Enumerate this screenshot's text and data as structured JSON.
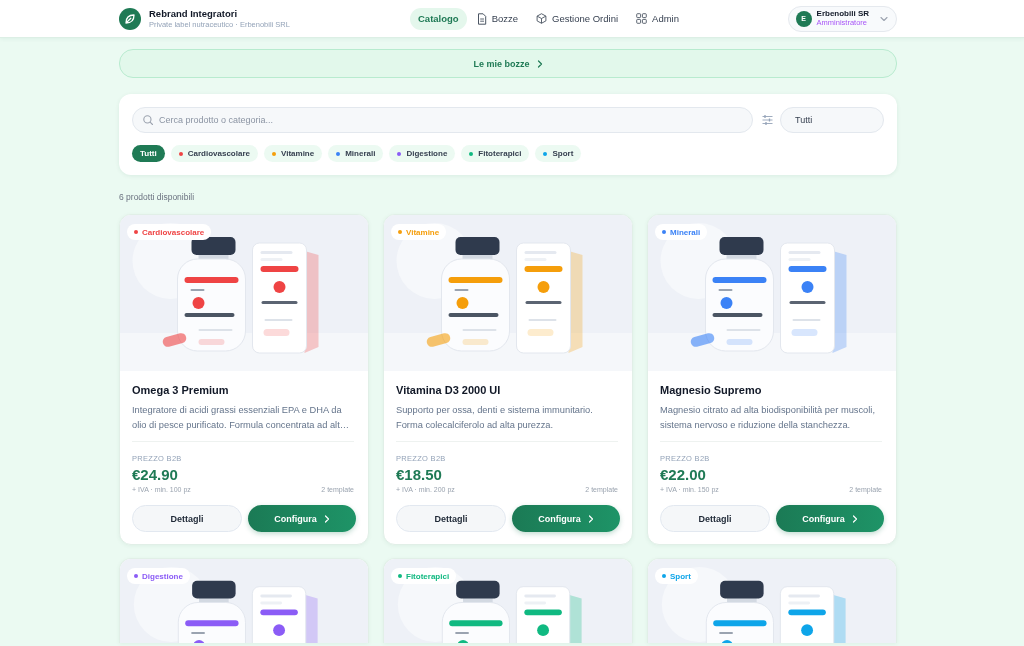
{
  "header": {
    "title": "Rebrand Integratori",
    "subtitle": "Private label nutraceutico · Erbenobili SRL"
  },
  "nav": [
    {
      "label": "Catalogo",
      "selected": true
    },
    {
      "label": "Bozze",
      "selected": false
    },
    {
      "label": "Gestione Ordini",
      "selected": false
    },
    {
      "label": "Admin",
      "selected": false
    }
  ],
  "user": {
    "initial": "E",
    "name": "Erbenobili SR",
    "role": "Amministratore"
  },
  "drafts_link": {
    "label": "Le mie bozze"
  },
  "filters": {
    "search": {
      "placeholder": "Cerca prodotto o categoria..."
    },
    "select": {
      "value": "Tutti"
    },
    "chips": [
      {
        "label": "Tutti",
        "selected": true
      },
      {
        "label": "Cardiovascolare",
        "selected": false,
        "color": "#ef4444"
      },
      {
        "label": "Vitamine",
        "selected": false,
        "color": "#f59e0b"
      },
      {
        "label": "Minerali",
        "selected": false,
        "color": "#3b82f6"
      },
      {
        "label": "Digestione",
        "selected": false,
        "color": "#8b5cf6"
      },
      {
        "label": "Fitoterapici",
        "selected": false,
        "color": "#10b981"
      },
      {
        "label": "Sport",
        "selected": false,
        "color": "#0ea5e9"
      }
    ]
  },
  "result_count": "6 prodotti disponibili",
  "products": [
    {
      "category": "Cardiovascolare",
      "color": "#ef4444",
      "name": "Omega 3 Premium",
      "description": "Integratore di acidi grassi essenziali EPA e DHA da olio di pesce purificato. Formula concentrata ad alt…",
      "price_label": "PREZZO B2B",
      "price": "€24.90",
      "terms": "+ IVA · min. 100 pz",
      "templates": "2 template",
      "details_button": "Dettagli",
      "configure_button": "Configura"
    },
    {
      "category": "Vitamine",
      "color": "#f59e0b",
      "name": "Vitamina D3 2000 UI",
      "description": "Supporto per ossa, denti e sistema immunitario. Forma colecalciferolo ad alta purezza.",
      "price_label": "PREZZO B2B",
      "price": "€18.50",
      "terms": "+ IVA · min. 200 pz",
      "templates": "2 template",
      "details_button": "Dettagli",
      "configure_button": "Configura"
    },
    {
      "category": "Minerali",
      "color": "#3b82f6",
      "name": "Magnesio Supremo",
      "description": "Magnesio citrato ad alta biodisponibilità per muscoli, sistema nervoso e riduzione della stanchezza.",
      "price_label": "PREZZO B2B",
      "price": "€22.00",
      "terms": "+ IVA · min. 150 pz",
      "templates": "2 template",
      "details_button": "Dettagli",
      "configure_button": "Configura"
    },
    {
      "category": "Digestione",
      "color": "#8b5cf6"
    },
    {
      "category": "Fitoterapici",
      "color": "#10b981"
    },
    {
      "category": "Sport",
      "color": "#0ea5e9"
    }
  ]
}
